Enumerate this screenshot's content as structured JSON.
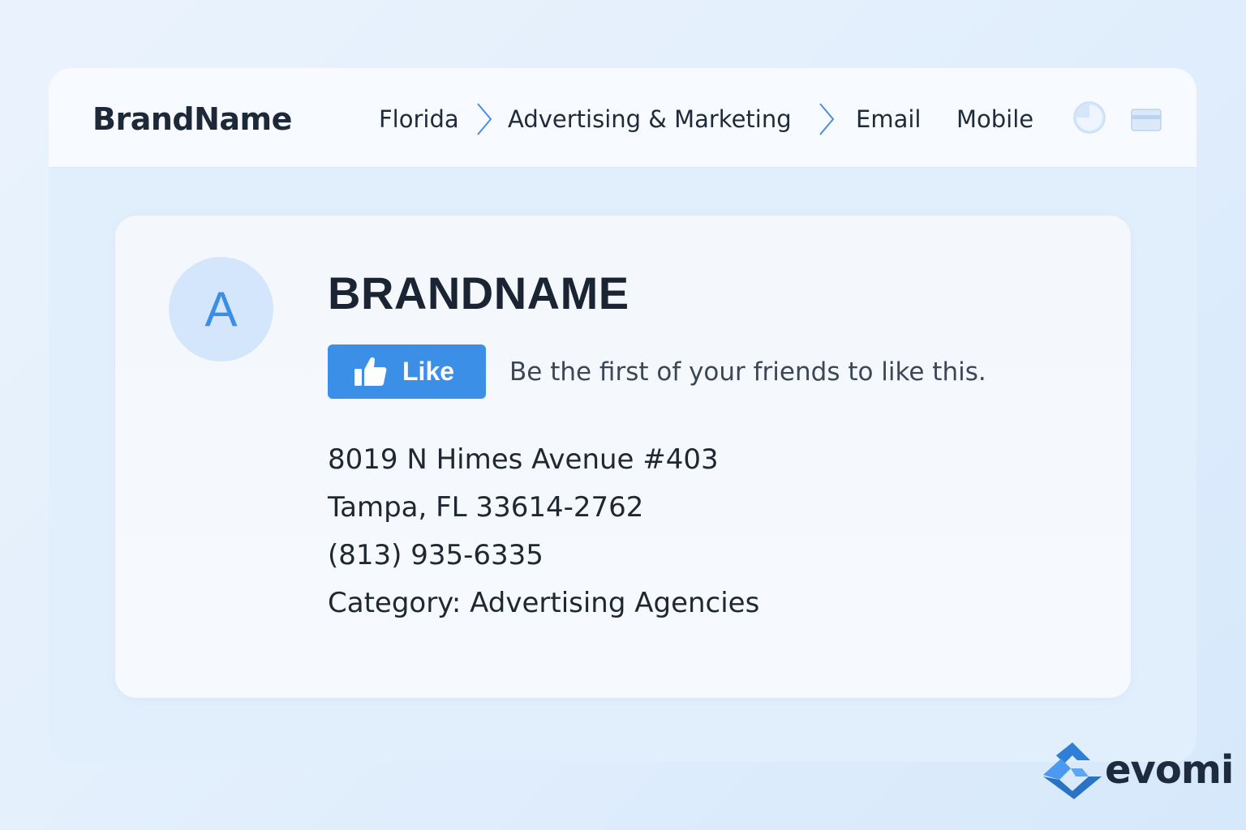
{
  "header": {
    "brand": "BrandName",
    "nav": [
      "Florida",
      "Advertising & Marketing",
      "Email",
      "Mobile"
    ],
    "icons": [
      "clock-icon",
      "card-icon"
    ]
  },
  "listing": {
    "avatar_letter": "A",
    "name": "BRANDNAME",
    "like_label": "Like",
    "like_text": "Be the first of your friends to like this.",
    "address_line1": "8019 N Himes Avenue #403",
    "address_line2": "Tampa, FL 33614-2762",
    "phone": "(813) 935-6335",
    "category": "Category: Advertising Agencies"
  },
  "watermark": {
    "text": "evomi"
  },
  "colors": {
    "accent": "#3b8fe6",
    "text_dark": "#1d2838",
    "avatar_bg": "#d4e6fb"
  }
}
